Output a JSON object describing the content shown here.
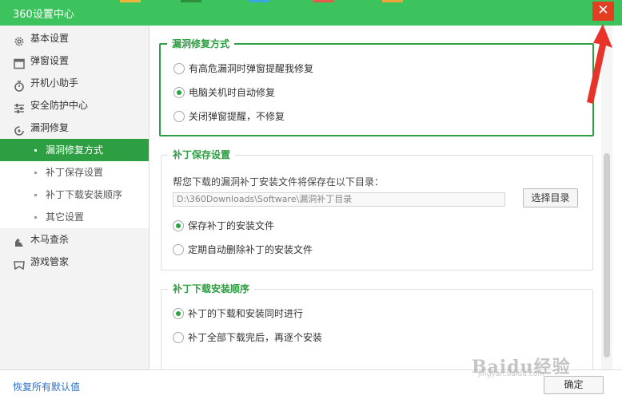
{
  "window": {
    "title": "360设置中心",
    "close_glyph": "✕"
  },
  "sidebar": {
    "items": [
      {
        "label": "基本设置",
        "icon": "gear-icon"
      },
      {
        "label": "弹窗设置",
        "icon": "window-icon"
      },
      {
        "label": "开机小助手",
        "icon": "stopwatch-icon"
      },
      {
        "label": "安全防护中心",
        "icon": "sliders-icon"
      },
      {
        "label": "漏洞修复",
        "icon": "refresh-icon"
      }
    ],
    "sub_items": [
      {
        "label": "漏洞修复方式",
        "active": true
      },
      {
        "label": "补丁保存设置",
        "active": false
      },
      {
        "label": "补丁下载安装顺序",
        "active": false
      },
      {
        "label": "其它设置",
        "active": false
      }
    ],
    "items_after": [
      {
        "label": "木马查杀",
        "icon": "trojan-icon"
      },
      {
        "label": "游戏管家",
        "icon": "gamepad-icon"
      }
    ]
  },
  "sections": {
    "repair_method": {
      "title": "漏洞修复方式",
      "options": [
        {
          "label": "有高危漏洞时弹窗提醒我修复",
          "checked": false
        },
        {
          "label": "电脑关机时自动修复",
          "checked": true
        },
        {
          "label": "关闭弹窗提醒，不修复",
          "checked": false
        }
      ]
    },
    "patch_save": {
      "title": "补丁保存设置",
      "description": "帮您下载的漏洞补丁安装文件将保存在以下目录：",
      "path": "D:\\360Downloads\\Software\\漏洞补丁目录",
      "choose_button": "选择目录",
      "options": [
        {
          "label": "保存补丁的安装文件",
          "checked": true
        },
        {
          "label": "定期自动删除补丁的安装文件",
          "checked": false
        }
      ]
    },
    "install_order": {
      "title": "补丁下载安装顺序",
      "options": [
        {
          "label": "补丁的下载和安装同时进行",
          "checked": true
        },
        {
          "label": "补丁全部下载完后，再逐个安装",
          "checked": false
        }
      ]
    }
  },
  "footer": {
    "restore_label": "恢复所有默认值",
    "ok_label": "确定"
  },
  "watermark": {
    "brand": "Baidu经验",
    "url": "jingyan.baidu.com"
  },
  "colors": {
    "titlebar": "#3cc35e",
    "accent": "#2e9e42",
    "close": "#e33d22",
    "link": "#2a6fd1",
    "arrow": "#e8332a"
  }
}
